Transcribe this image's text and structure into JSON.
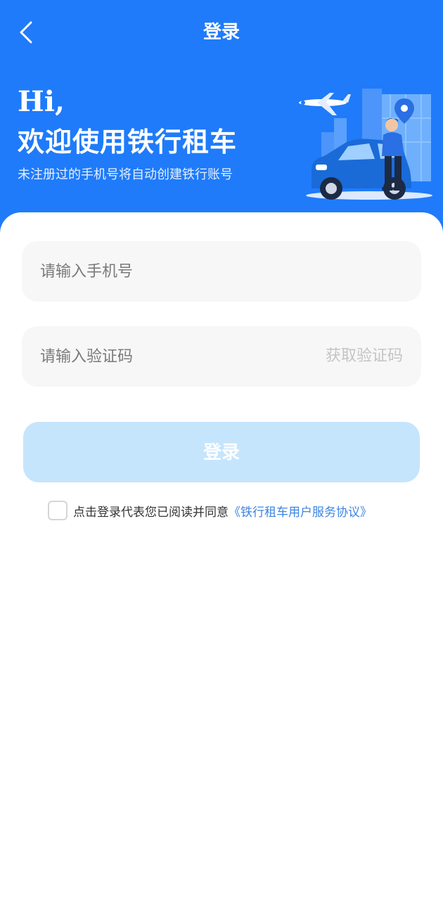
{
  "nav": {
    "title": "登录",
    "back_icon": "chevron-left-icon"
  },
  "hero": {
    "greeting": "Hi,",
    "welcome": "欢迎使用铁行租车",
    "subtitle": "未注册过的手机号将自动创建铁行账号",
    "background_color": "#1f7bfa",
    "illustration": "car-rental-illustration"
  },
  "form": {
    "phone_placeholder": "请输入手机号",
    "phone_value": "",
    "code_placeholder": "请输入验证码",
    "code_value": "",
    "get_code_label": "获取验证码",
    "login_label": "登录",
    "login_button_color": "#c5e5fd"
  },
  "agreement": {
    "checked": false,
    "text": "点击登录代表您已阅读并同意",
    "link": "《铁行租车用户服务协议》",
    "link_color": "#3d84e3"
  }
}
